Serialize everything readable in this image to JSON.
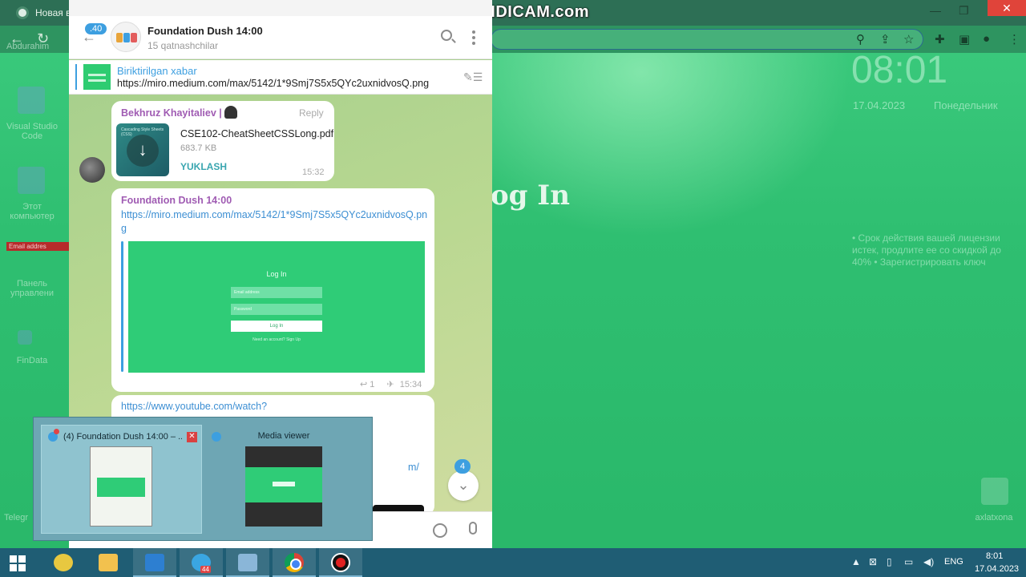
{
  "overlay": {
    "recorder_watermark": "www.BANDICAM.com"
  },
  "browser": {
    "tab_title": "Новая вк",
    "account_label": "Abdurahim",
    "win_minimize": "—",
    "win_restore": "❐",
    "win_close": "✕"
  },
  "desktop": {
    "clock_big": "08:01",
    "date_big": "17.04.2023",
    "day_big": "Понедельник",
    "login_heading": "og In",
    "widget_note": "• Срок действия вашей лицензии истек, продлите ее со скидкой до 40% • Зарегистрировать ключ",
    "icons": [
      {
        "label": "Visual Studio Code"
      },
      {
        "label": "Этот компьютер"
      },
      {
        "label": "Панель управлени"
      },
      {
        "label": "FinData"
      },
      {
        "label": "Telegr"
      },
      {
        "label": "axlatxona"
      }
    ],
    "email_strip": "Email addres"
  },
  "telegram": {
    "unread_count": ".40",
    "group_title": "Foundation Dush 14:00",
    "group_subtitle": "15 qatnashchilar",
    "pinned": {
      "title": "Biriktirilgan xabar",
      "url": "https://miro.medium.com/max/5142/1*9Smj7S5x5QYc2uxnidvosQ.png"
    },
    "messages": {
      "file_msg": {
        "sender": "Bekhruz Khayitaliev |",
        "reply": "Reply",
        "thumb_caption": "Cascading Style Sheets (CSS)",
        "file_name": "CSE102-CheatSheetCSSLong.pdf",
        "file_size": "683.7 KB",
        "action": "YUKLASH",
        "time": "15:32"
      },
      "link_msg": {
        "sender": "Foundation Dush 14:00",
        "link": "https://miro.medium.com/max/5142/1*9Smj7S5x5QYc2uxnidvosQ.png",
        "preview_title": "Log In",
        "preview_email": "Email address",
        "preview_password": "Password",
        "preview_button": "Log In",
        "preview_footer": "Need an account? Sign Up",
        "replies": "↩ 1",
        "time": "15:34"
      },
      "youtube_msg": {
        "link": "https://www.youtube.com/watch?",
        "link_tail": "m/"
      }
    },
    "scroll_badge": "4"
  },
  "taskbar_preview": {
    "item1_title": "(4) Foundation Dush 14:00 – ...",
    "item1_close": "✕",
    "item2_title": "Media viewer"
  },
  "taskbar": {
    "tg_badge": "44",
    "lang": "ENG",
    "time": "8:01",
    "date": "17.04.2023"
  }
}
